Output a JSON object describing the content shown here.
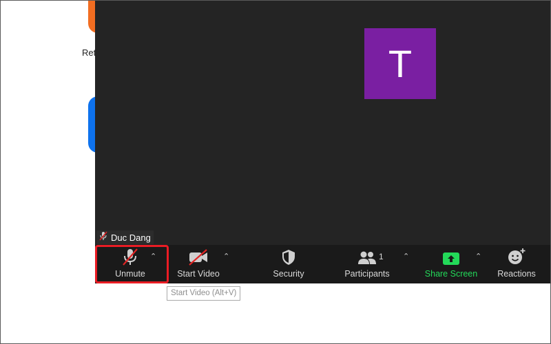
{
  "desktop": {
    "partial_text": "Ret"
  },
  "meeting": {
    "avatar_initial": "T",
    "participant_name": "Duc Dang"
  },
  "toolbar": {
    "unmute_label": "Unmute",
    "start_video_label": "Start Video",
    "security_label": "Security",
    "participants_label": "Participants",
    "participants_count": "1",
    "share_screen_label": "Share Screen",
    "reactions_label": "Reactions"
  },
  "tooltip": {
    "text": "Start Video (Alt+V)"
  },
  "colors": {
    "avatar": "#7a1fa2",
    "share_green": "#23d959",
    "highlight_red": "#ea1c24",
    "toolbar_bg": "#1a1a1a",
    "stage_bg": "#242424"
  }
}
